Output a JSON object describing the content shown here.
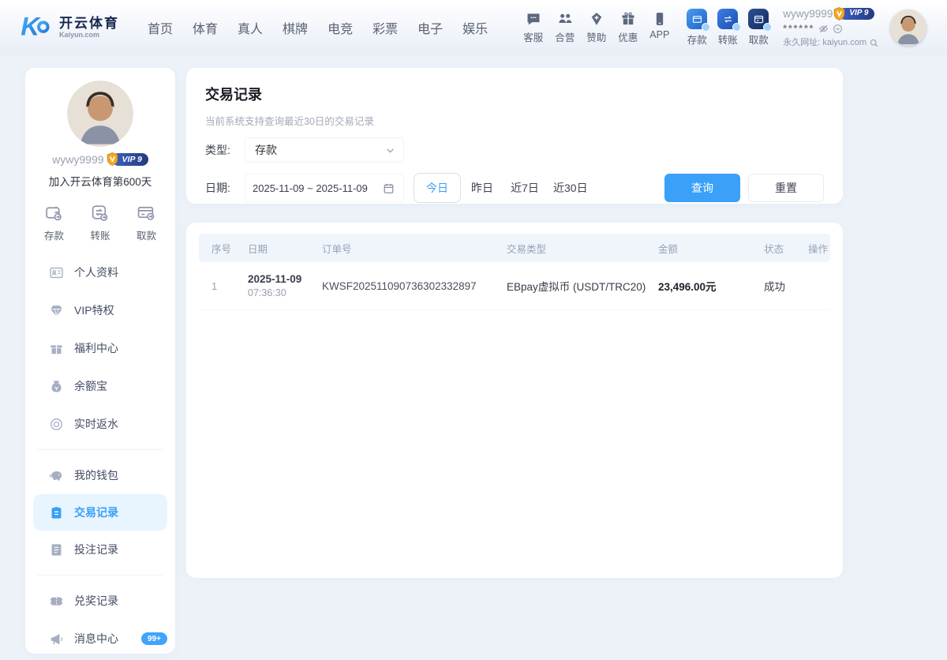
{
  "brand": {
    "name": "开云体育",
    "domain": "Kaiyun.com"
  },
  "nav": {
    "items": [
      "首页",
      "体育",
      "真人",
      "棋牌",
      "电竞",
      "彩票",
      "电子",
      "娱乐"
    ]
  },
  "header": {
    "services": [
      {
        "label": "客服"
      },
      {
        "label": "合营"
      },
      {
        "label": "赞助"
      },
      {
        "label": "优惠"
      },
      {
        "label": "APP"
      }
    ],
    "wallet": [
      {
        "label": "存款"
      },
      {
        "label": "转账"
      },
      {
        "label": "取款"
      }
    ],
    "user": {
      "username": "wywy9999",
      "vip_label": "VIP 9",
      "masked_secret": "******",
      "url_label": "永久网址:",
      "url_value": "kaiyun.com"
    }
  },
  "sidebar": {
    "username": "wywy9999",
    "vip_label": "VIP 9",
    "joined_text": "加入开云体育第600天",
    "quick_actions": [
      {
        "label": "存款"
      },
      {
        "label": "转账"
      },
      {
        "label": "取款"
      }
    ],
    "menu": {
      "group1": [
        {
          "label": "个人资料"
        },
        {
          "label": "VIP特权"
        },
        {
          "label": "福利中心"
        },
        {
          "label": "余额宝"
        },
        {
          "label": "实时返水"
        }
      ],
      "group2": [
        {
          "label": "我的钱包"
        },
        {
          "label": "交易记录"
        },
        {
          "label": "投注记录"
        }
      ],
      "group3": [
        {
          "label": "兑奖记录"
        },
        {
          "label": "消息中心",
          "badge": "99+"
        }
      ]
    },
    "active_item": "交易记录"
  },
  "main": {
    "title": "交易记录",
    "subtitle": "当前系统支持查询最近30日的交易记录",
    "filter": {
      "type_label": "类型:",
      "type_value": "存款",
      "date_label": "日期:",
      "date_range": "2025-11-09  ~  2025-11-09",
      "quick_ranges": [
        "今日",
        "昨日",
        "近7日",
        "近30日"
      ],
      "active_range": "今日",
      "query_label": "查询",
      "reset_label": "重置"
    },
    "table": {
      "columns": [
        "序号",
        "日期",
        "订单号",
        "交易类型",
        "金额",
        "状态",
        "操作"
      ],
      "rows": [
        {
          "index": "1",
          "date": "2025-11-09",
          "time": "07:36:30",
          "order_no": "KWSF202511090736302332897",
          "type": "EBpay虚拟币 (USDT/TRC20)",
          "amount": "23,496.00元",
          "status": "成功"
        }
      ]
    }
  },
  "colors": {
    "accent": "#3aa0f8",
    "active_item_bg": "#e8f4fe",
    "table_header_bg": "#f0f5fb",
    "vip_gold": "#f6a821",
    "vip_pill": "#2d4392"
  }
}
